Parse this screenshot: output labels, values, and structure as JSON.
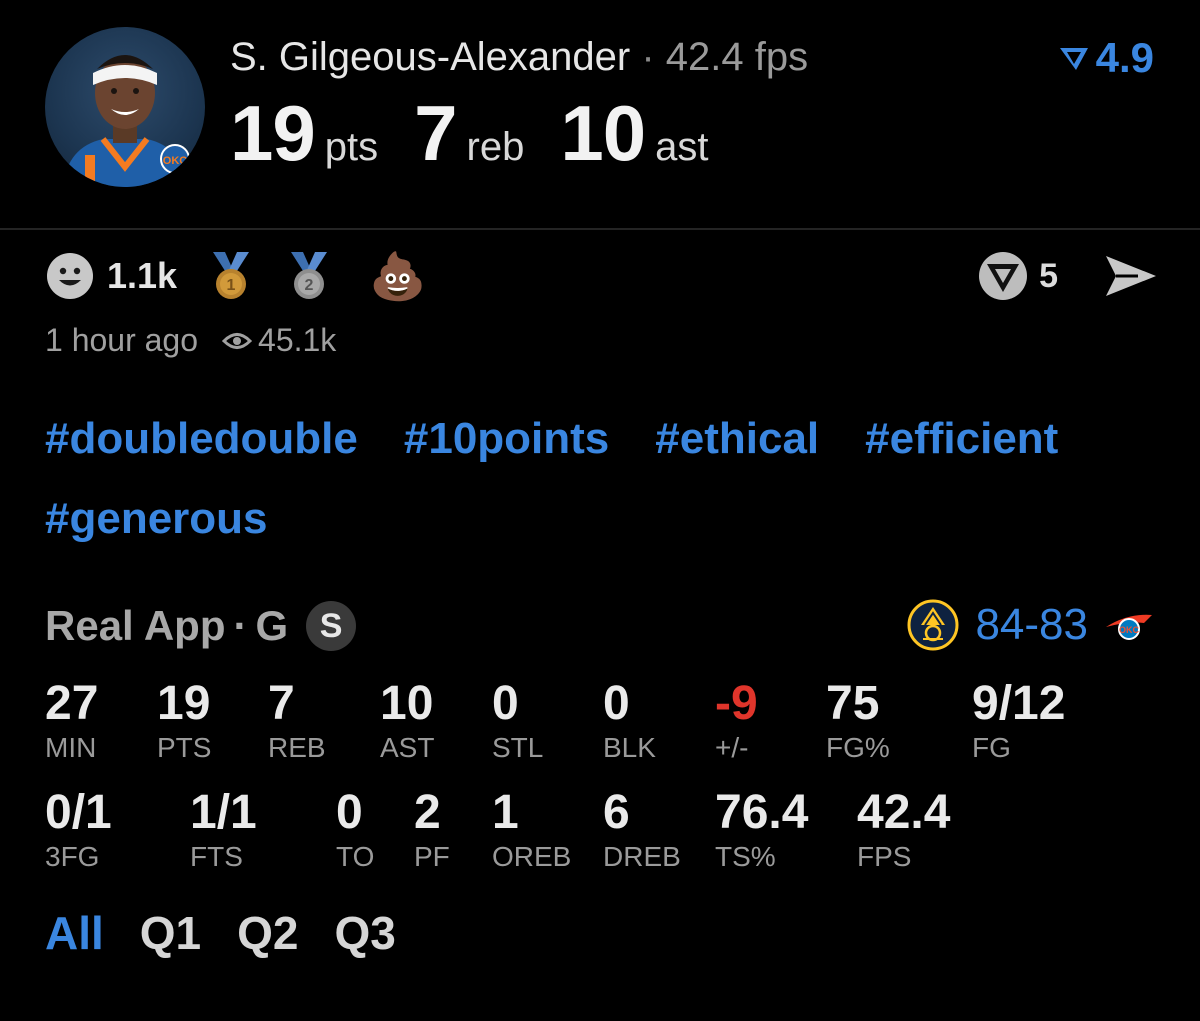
{
  "header": {
    "player_name": "S. Gilgeous-Alexander",
    "separator": "·",
    "fps_text": "42.4 fps",
    "rating": "4.9",
    "pts_value": "19",
    "pts_unit": "pts",
    "reb_value": "7",
    "reb_unit": "reb",
    "ast_value": "10",
    "ast_unit": "ast"
  },
  "reactions": {
    "smile_count": "1.1k",
    "medal_gold_num": "1",
    "medal_silver_num": "2",
    "poop_emoji": "💩",
    "vote_count": "5"
  },
  "meta": {
    "time_ago": "1 hour ago",
    "views": "45.1k"
  },
  "tags": [
    "#doubledouble",
    "#10points",
    "#ethical",
    "#efficient",
    "#generous"
  ],
  "game": {
    "source": "Real App",
    "separator": "·",
    "position": "G",
    "badge": "S",
    "score_a": "84",
    "score_dash": "-",
    "score_b": "83"
  },
  "stats_row1": [
    {
      "value": "27",
      "label": "MIN"
    },
    {
      "value": "19",
      "label": "PTS"
    },
    {
      "value": "7",
      "label": "REB"
    },
    {
      "value": "10",
      "label": "AST"
    },
    {
      "value": "0",
      "label": "STL"
    },
    {
      "value": "0",
      "label": "BLK"
    },
    {
      "value": "-9",
      "label": "+/-"
    },
    {
      "value": "75",
      "label": "FG%"
    },
    {
      "value": "9/12",
      "label": "FG"
    }
  ],
  "stats_row2": [
    {
      "value": "0/1",
      "label": "3FG"
    },
    {
      "value": "1/1",
      "label": "FTS"
    },
    {
      "value": "0",
      "label": "TO"
    },
    {
      "value": "2",
      "label": "PF"
    },
    {
      "value": "1",
      "label": "OREB"
    },
    {
      "value": "6",
      "label": "DREB"
    },
    {
      "value": "76.4",
      "label": "TS%"
    },
    {
      "value": "42.4",
      "label": "FPS"
    }
  ],
  "tabs": [
    "All",
    "Q1",
    "Q2",
    "Q3"
  ],
  "colors": {
    "accent": "#3a86e0",
    "negative": "#e0352b",
    "background": "#000000"
  }
}
